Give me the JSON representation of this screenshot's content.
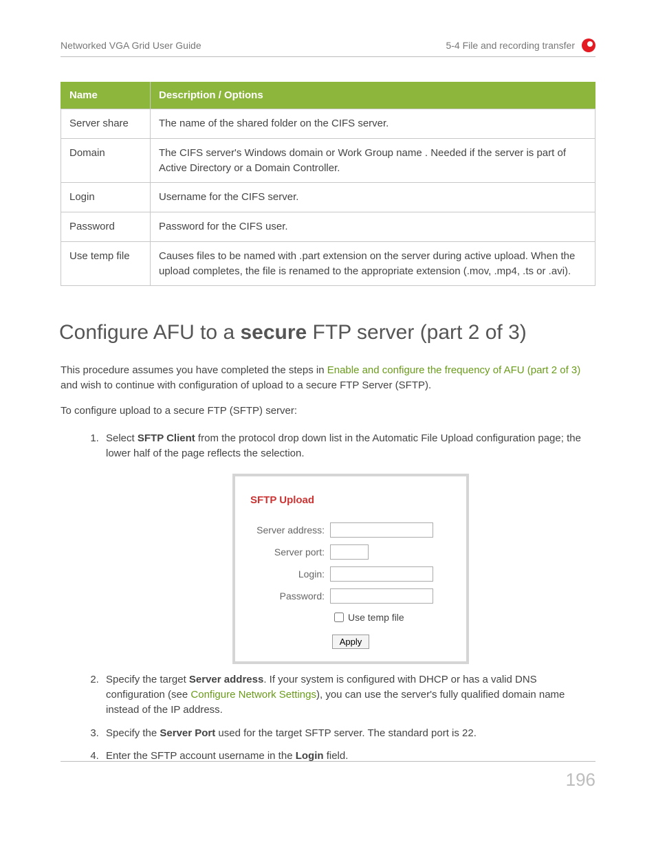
{
  "header": {
    "left": "Networked VGA Grid User Guide",
    "right": "5-4 File and recording transfer"
  },
  "table": {
    "headers": [
      "Name",
      "Description / Options"
    ],
    "rows": [
      {
        "name": "Server share",
        "desc": "The name of the shared folder on the CIFS server."
      },
      {
        "name": "Domain",
        "desc": "The CIFS server's Windows domain or Work Group name . Needed if the server is part of Active Directory or a Domain Controller."
      },
      {
        "name": "Login",
        "desc": "Username for the CIFS server."
      },
      {
        "name": "Password",
        "desc": "Password for the CIFS user."
      },
      {
        "name": "Use temp file",
        "desc": "Causes files to be named with .part extension on the server during active upload. When the upload completes, the file is renamed to the appropriate extension (.mov, .mp4, .ts or .avi)."
      }
    ]
  },
  "section": {
    "title_prefix": "Configure AFU to a ",
    "title_bold": "secure",
    "title_suffix": " FTP server (part 2 of 3)",
    "intro_pre": "This procedure assumes you have completed the steps in ",
    "intro_link": "Enable and configure the frequency of AFU (part 2 of 3)",
    "intro_post": " and wish to continue with configuration of upload to a secure FTP Server (SFTP).",
    "intro2": "To configure upload to a secure FTP (SFTP) server:"
  },
  "steps": {
    "s1_pre": "Select ",
    "s1_bold": "SFTP Client",
    "s1_post": " from the protocol drop down list in the Automatic File Upload configuration page; the lower half of the page reflects the selection.",
    "s2_pre": "Specify the target ",
    "s2_bold": "Server address",
    "s2_mid": ". If your system is configured with DHCP or has a valid DNS configuration (see ",
    "s2_link": "Configure Network Settings",
    "s2_post": "), you can use the server's fully qualified domain name instead of the IP address.",
    "s3_pre": "Specify the ",
    "s3_bold": "Server Port",
    "s3_post": " used for the target SFTP server. The standard port is 22.",
    "s4_pre": "Enter the SFTP account username in the ",
    "s4_bold": "Login",
    "s4_post": " field."
  },
  "screenshot": {
    "title": "SFTP Upload",
    "labels": {
      "server_address": "Server address:",
      "server_port": "Server port:",
      "login": "Login:",
      "password": "Password:",
      "use_temp": "Use temp file",
      "apply": "Apply"
    },
    "values": {
      "server_address": "",
      "server_port": "",
      "login": "",
      "password": ""
    }
  },
  "footer": {
    "page": "196"
  }
}
